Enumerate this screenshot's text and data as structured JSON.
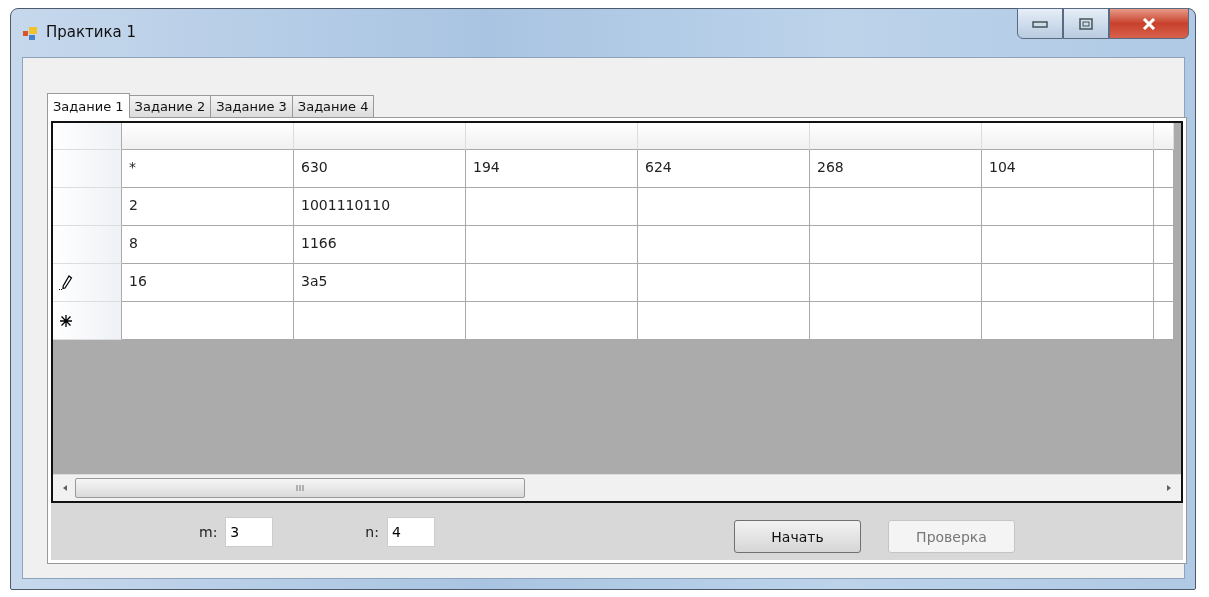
{
  "window": {
    "title": "Практика 1"
  },
  "tabs": [
    {
      "label": "Задание 1",
      "selected": true
    },
    {
      "label": "Задание 2",
      "selected": false
    },
    {
      "label": "Задание 3",
      "selected": false
    },
    {
      "label": "Задание 4",
      "selected": false
    }
  ],
  "grid": {
    "rows": [
      {
        "kind": "data",
        "cells": [
          "*",
          "630",
          "194",
          "624",
          "268",
          "104"
        ]
      },
      {
        "kind": "data",
        "cells": [
          "2",
          "1001110110"
        ]
      },
      {
        "kind": "data",
        "cells": [
          "8",
          "1166"
        ]
      },
      {
        "kind": "editing",
        "cells": [
          "16",
          "3a5"
        ]
      },
      {
        "kind": "new"
      }
    ]
  },
  "inputs": [
    {
      "label": "m:",
      "value": "3"
    },
    {
      "label": "n:",
      "value": "4"
    }
  ],
  "buttons": [
    {
      "label": "Начать",
      "disabled": false
    },
    {
      "label": "Проверка",
      "disabled": true
    }
  ]
}
